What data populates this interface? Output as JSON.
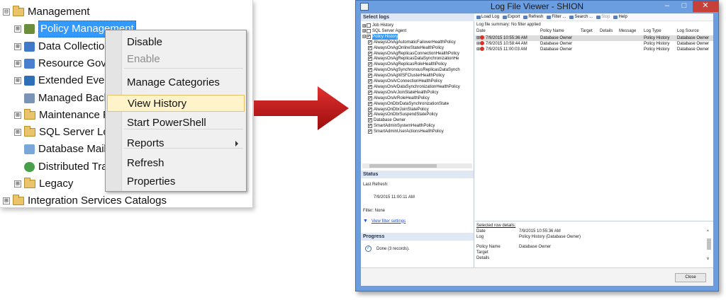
{
  "tree": {
    "items": [
      {
        "name": "tree-item-management",
        "label": "Management",
        "expander": "⊟",
        "icon": "folder"
      },
      {
        "name": "tree-item-policy-management",
        "label": "Policy Management",
        "expander": "⊞",
        "icon": "pol"
      },
      {
        "name": "tree-item-data-collection",
        "label": "Data Collection",
        "expander": "⊞",
        "icon": "dc"
      },
      {
        "name": "tree-item-resource-governor",
        "label": "Resource Gove",
        "expander": "⊞",
        "icon": "rg"
      },
      {
        "name": "tree-item-extended-events",
        "label": "Extended Even",
        "expander": "⊞",
        "icon": "ee"
      },
      {
        "name": "tree-item-managed-backup",
        "label": "Managed Back",
        "expander": "",
        "icon": "mb"
      },
      {
        "name": "tree-item-maintenance-plans",
        "label": "Maintenance P",
        "expander": "⊞",
        "icon": "folder"
      },
      {
        "name": "tree-item-sql-server-logs",
        "label": "SQL Server Log",
        "expander": "⊞",
        "icon": "folder"
      },
      {
        "name": "tree-item-database-mail",
        "label": "Database Mail",
        "expander": "",
        "icon": "dm"
      },
      {
        "name": "tree-item-distributed-transaction",
        "label": "Distributed Tra",
        "expander": "",
        "icon": "dt"
      },
      {
        "name": "tree-item-legacy",
        "label": "Legacy",
        "expander": "⊞",
        "icon": "folder"
      },
      {
        "name": "tree-item-integration-services",
        "label": "Integration Services Catalogs",
        "expander": "⊞",
        "icon": "folder"
      }
    ]
  },
  "context_menu": {
    "items": [
      {
        "label": "Disable",
        "state": "enabled"
      },
      {
        "label": "Enable",
        "state": "disabled"
      },
      {
        "label": "Manage Categories",
        "state": "enabled"
      },
      {
        "label": "View History",
        "state": "highlighted"
      },
      {
        "label": "Start PowerShell",
        "state": "enabled"
      },
      {
        "label": "Reports",
        "state": "submenu"
      },
      {
        "label": "Refresh",
        "state": "enabled"
      },
      {
        "label": "Properties",
        "state": "enabled"
      }
    ]
  },
  "viewer": {
    "title": "Log File Viewer - SHION",
    "window_buttons": {
      "minimize": "–",
      "maximize": "□",
      "close": "✕"
    },
    "select_logs_header": "Select logs",
    "logs": [
      {
        "label": "Job History",
        "checked": false,
        "expander": "⊞",
        "indent": 0
      },
      {
        "label": "SQL Server Agent",
        "checked": false,
        "expander": "⊞",
        "indent": 0
      },
      {
        "label": "Policy History",
        "checked": true,
        "expander": "⊟",
        "indent": 0,
        "selected": true
      },
      {
        "label": "AlwaysOnAgAutomaticFailoverHealthPolicy",
        "checked": true,
        "indent": 1
      },
      {
        "label": "AlwaysOnAgOnlineStateHealthPolicy",
        "checked": true,
        "indent": 1
      },
      {
        "label": "AlwaysOnAgReplicasConnectionHealthPolicy",
        "checked": true,
        "indent": 1
      },
      {
        "label": "AlwaysOnAgReplicasDataSynchronizationHe",
        "checked": true,
        "indent": 1
      },
      {
        "label": "AlwaysOnAgReplicasRoleHealthPolicy",
        "checked": true,
        "indent": 1
      },
      {
        "label": "AlwaysOnAgSynchronousReplicasDataSynch",
        "checked": true,
        "indent": 1
      },
      {
        "label": "AlwaysOnAgWSFClusterHealthPolicy",
        "checked": true,
        "indent": 1
      },
      {
        "label": "AlwaysOnArConnectionHealthPolicy",
        "checked": true,
        "indent": 1
      },
      {
        "label": "AlwaysOnArDataSynchronizationHealthPolicy",
        "checked": true,
        "indent": 1
      },
      {
        "label": "AlwaysOnArJoinStateHealthPolicy",
        "checked": true,
        "indent": 1
      },
      {
        "label": "AlwaysOnArRoleHealthPolicy",
        "checked": true,
        "indent": 1
      },
      {
        "label": "AlwaysOnDbrDataSynchronizationState",
        "checked": true,
        "indent": 1
      },
      {
        "label": "AlwaysOnDbrJoinStatePolicy",
        "checked": true,
        "indent": 1
      },
      {
        "label": "AlwaysOnDbrSuspendStatePolicy",
        "checked": true,
        "indent": 1
      },
      {
        "label": "Database Owner",
        "checked": true,
        "indent": 1
      },
      {
        "label": "SmartAdminSystemHealthPolicy",
        "checked": true,
        "indent": 1
      },
      {
        "label": "SmartAdminUserActionsHealthPolicy",
        "checked": true,
        "indent": 1
      }
    ],
    "status": {
      "header": "Status",
      "last_refresh_label": "Last Refresh:",
      "last_refresh_value": "7/9/2015 11:00:11 AM",
      "filter_label": "Filter: None",
      "filter_link": "View filter settings"
    },
    "progress": {
      "header": "Progress",
      "text": "Done (3 records)."
    },
    "toolbar": [
      {
        "name": "load-log-button",
        "label": "Load Log",
        "enabled": true
      },
      {
        "name": "export-button",
        "label": "Export",
        "enabled": true
      },
      {
        "name": "refresh-button",
        "label": "Refresh",
        "enabled": true
      },
      {
        "name": "filter-button",
        "label": "Filter ...",
        "enabled": true
      },
      {
        "name": "search-button",
        "label": "Search ...",
        "enabled": true
      },
      {
        "name": "stop-button",
        "label": "Stop",
        "enabled": false
      },
      {
        "name": "help-button",
        "label": "Help",
        "enabled": true
      }
    ],
    "log_summary": "Log file summary: No filter applied",
    "grid": {
      "columns": [
        "Date",
        "Policy Name",
        "Target",
        "Details",
        "Message",
        "Log Type",
        "Log Source"
      ],
      "rows": [
        {
          "date": "7/9/2015 10:55:36 AM",
          "policy": "Database Owner",
          "target": "",
          "details": "",
          "message": "",
          "log_type": "Policy History",
          "log_source": "Database Owner",
          "selected": true
        },
        {
          "date": "7/9/2015 10:58:44 AM",
          "policy": "Database Owner",
          "target": "",
          "details": "",
          "message": "",
          "log_type": "Policy History",
          "log_source": "Database Owner",
          "selected": false
        },
        {
          "date": "7/9/2015 11:00:03 AM",
          "policy": "Database Owner",
          "target": "",
          "details": "",
          "message": "",
          "log_type": "Policy History",
          "log_source": "Database Owner",
          "selected": false
        }
      ]
    },
    "details": {
      "header": "Selected row details:",
      "fields": [
        {
          "label": "Date",
          "value": "7/9/2015 10:55:36 AM"
        },
        {
          "label": "Log",
          "value": "Policy History (Database Owner)"
        },
        {
          "label": "Policy Name",
          "value": "Database Owner"
        },
        {
          "label": "Target",
          "value": ""
        },
        {
          "label": "Details",
          "value": ""
        }
      ]
    },
    "close_label": "Close"
  },
  "colors": {
    "accent": "#3399ff",
    "titlebar": "#6b9ee0",
    "arrow": "#c01818",
    "menu_highlight": "#fff3c9"
  }
}
